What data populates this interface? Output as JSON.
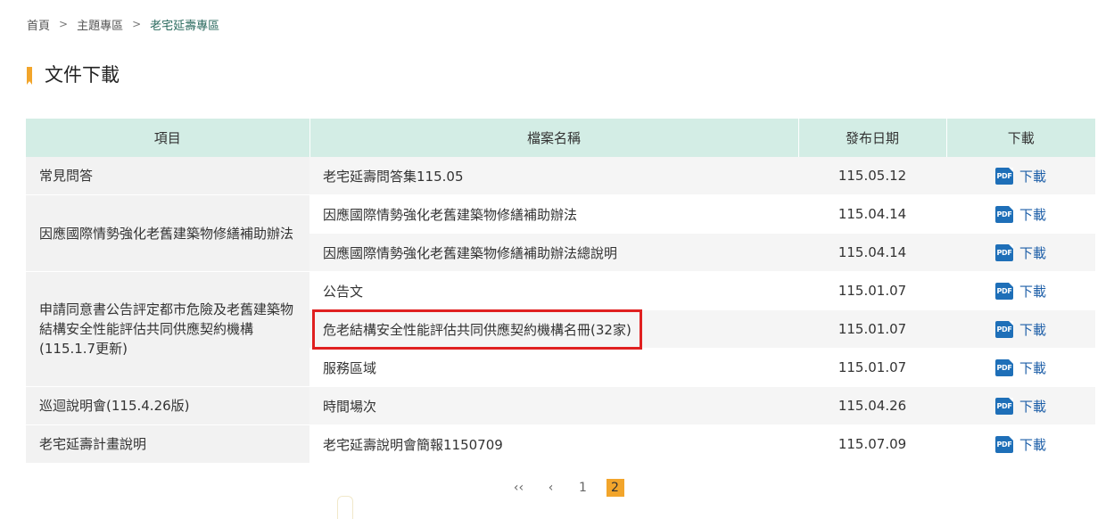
{
  "breadcrumb": {
    "home": "首頁",
    "theme": "主題專區",
    "current": "老宅延壽專區",
    "separator": ">"
  },
  "section": {
    "title": "文件下載"
  },
  "table": {
    "headers": {
      "item": "項目",
      "file": "檔案名稱",
      "date": "發布日期",
      "download": "下載"
    },
    "groups": [
      {
        "item": "常見問答",
        "files": [
          {
            "name": "老宅延壽問答集115.05",
            "date": "115.05.12"
          }
        ]
      },
      {
        "item": "因應國際情勢強化老舊建築物修繕補助辦法",
        "files": [
          {
            "name": "因應國際情勢強化老舊建築物修繕補助辦法",
            "date": "115.04.14"
          },
          {
            "name": "因應國際情勢強化老舊建築物修繕補助辦法總說明",
            "date": "115.04.14"
          }
        ]
      },
      {
        "item": "申請同意書公告評定都市危險及老舊建築物結構安全性能評估共同供應契約機構(115.1.7更新)",
        "files": [
          {
            "name": "公告文",
            "date": "115.01.07"
          },
          {
            "name": "危老結構安全性能評估共同供應契約機構名冊(32家)",
            "date": "115.01.07"
          },
          {
            "name": "服務區域",
            "date": "115.01.07"
          }
        ]
      },
      {
        "item": "巡迴說明會(115.4.26版)",
        "files": [
          {
            "name": "時間場次",
            "date": "115.04.26"
          }
        ]
      },
      {
        "item": "老宅延壽計畫說明",
        "files": [
          {
            "name": "老宅延壽說明會簡報1150709",
            "date": "115.07.09"
          }
        ]
      }
    ],
    "download_label": "下載",
    "pdf_icon_text": "PDF"
  },
  "pagination": {
    "first": "‹‹",
    "prev": "‹",
    "pages": [
      "1",
      "2"
    ],
    "current": "2"
  },
  "colors": {
    "header_bg": "#d3ede5",
    "accent": "#f2a52b",
    "link": "#1e5fa8",
    "highlight": "#e02020"
  }
}
